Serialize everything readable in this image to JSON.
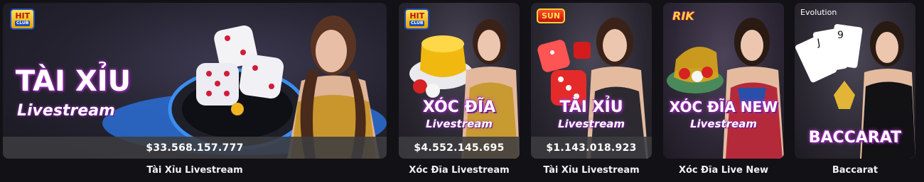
{
  "cards": [
    {
      "logo": "HIT",
      "logo_sub": "CLUB",
      "title": "TÀI XỈU",
      "subtitle": "Livestream",
      "jackpot": "$33.568.157.777",
      "name": "Tài Xỉu Livestream"
    },
    {
      "logo": "HIT",
      "logo_sub": "CLUB",
      "title": "XÓC ĐĨA",
      "subtitle": "Livestream",
      "jackpot": "$4.552.145.695",
      "name": "Xóc Đĩa Livestream"
    },
    {
      "logo": "SUN",
      "title": "TÀI XỈU",
      "subtitle": "Livestream",
      "jackpot": "$1.143.018.923",
      "name": "Tài Xỉu Livestream"
    },
    {
      "logo": "RIK",
      "title": "XÓC ĐĨA NEW",
      "subtitle": "Livestream",
      "name": "Xóc Đĩa Live New"
    },
    {
      "logo": "Evolution",
      "title": "BACCARAT",
      "name": "Baccarat"
    }
  ],
  "colors": {
    "page_bg": "#121116",
    "jackpot_bar": "#3c3c40",
    "title_glow": "#c13bd6"
  },
  "icons": [
    "dice-icon",
    "gold-bowl-icon",
    "playing-cards-icon",
    "evolution-logo-icon"
  ]
}
